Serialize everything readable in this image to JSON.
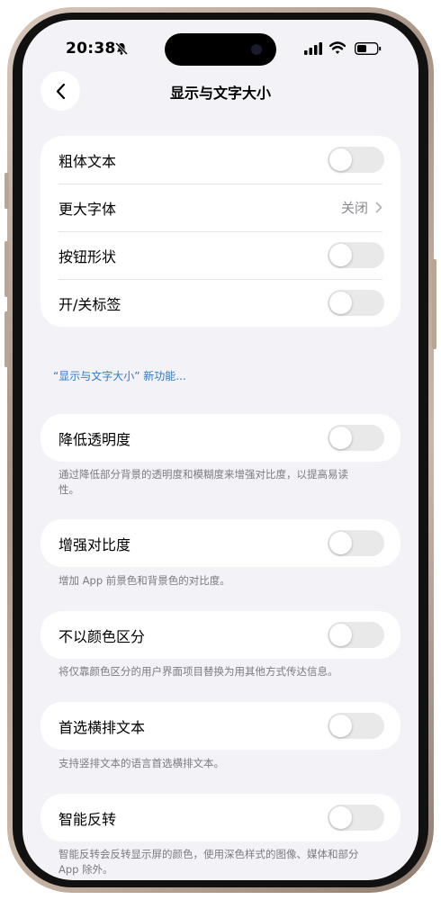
{
  "status_bar": {
    "time": "20:38",
    "icons": [
      "bell-slash-icon",
      "cellular-signal-icon",
      "wifi-icon",
      "battery-icon"
    ]
  },
  "nav": {
    "back_icon": "chevron-left-icon",
    "title": "显示与文字大小"
  },
  "group1": {
    "rows": [
      {
        "label": "粗体文本",
        "control": "toggle",
        "on": false
      },
      {
        "label": "更大字体",
        "control": "disclosure",
        "value": "关闭"
      },
      {
        "label": "按钮形状",
        "control": "toggle",
        "on": false
      },
      {
        "label": "开/关标签",
        "control": "toggle",
        "on": false
      }
    ]
  },
  "whats_new_link": "“显示与文字大小” 新功能...",
  "reduce_transparency": {
    "label": "降低透明度",
    "on": false,
    "footnote": "通过降低部分背景的透明度和模糊度来增强对比度，以提高易读性。"
  },
  "increase_contrast": {
    "label": "增强对比度",
    "on": false,
    "footnote": "增加 App 前景色和背景色的对比度。"
  },
  "differentiate_without_color": {
    "label": "不以颜色区分",
    "on": false,
    "footnote": "将仅靠颜色区分的用户界面项目替换为用其他方式传达信息。"
  },
  "prefer_horizontal_text": {
    "label": "首选横排文本",
    "on": false,
    "footnote": "支持竖排文本的语言首选横排文本。"
  },
  "smart_invert": {
    "label": "智能反转",
    "on": false,
    "footnote": "智能反转会反转显示屏的颜色，使用深色样式的图像、媒体和部分 App 除外。"
  },
  "colors": {
    "background": "#f2f2f7",
    "card": "#ffffff",
    "link": "#3478c5",
    "toggle_off": "#e9e9ea",
    "secondary_text": "#8a8a8e"
  }
}
